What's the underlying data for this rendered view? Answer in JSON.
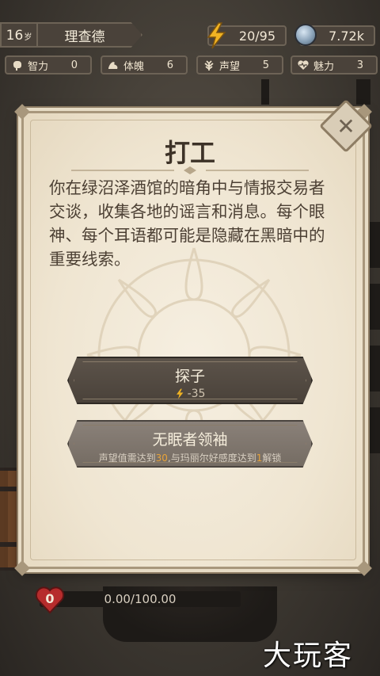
{
  "player": {
    "age": "16",
    "age_unit": "岁",
    "name": "理查德"
  },
  "resources": {
    "energy": "20/95",
    "coins": "7.72k",
    "energy_icon": "lightning-icon",
    "coin_icon": "coin-icon"
  },
  "stats": [
    {
      "label": "智力",
      "value": "0",
      "icon": "brain-icon"
    },
    {
      "label": "体魄",
      "value": "6",
      "icon": "arm-icon"
    },
    {
      "label": "声望",
      "value": "5",
      "icon": "laurel-icon"
    },
    {
      "label": "魅力",
      "value": "3",
      "icon": "heart-pulse-icon"
    }
  ],
  "modal": {
    "title": "打工",
    "description": "你在绿沼泽酒馆的暗角中与情报交易者交谈，收集各地的谣言和消息。每个眼神、每个耳语都可能是隐藏在黑暗中的重要线索。",
    "options": [
      {
        "label": "探子",
        "cost": "-35"
      },
      {
        "label": "无眠者领袖",
        "req_pre": "声望值需达到",
        "req_num1": "30",
        "req_mid": ",与玛丽尔好感度达到",
        "req_num2": "1",
        "req_post": "解锁"
      }
    ]
  },
  "health": {
    "value": "0",
    "bar_text": "0.00/100.00"
  },
  "watermark": "大玩客",
  "colors": {
    "panel": "#efe5d1",
    "button_dark": "#4a423a",
    "button_locked": "#7f766d",
    "highlight": "#e8a33a",
    "energy": "#f0b323"
  }
}
